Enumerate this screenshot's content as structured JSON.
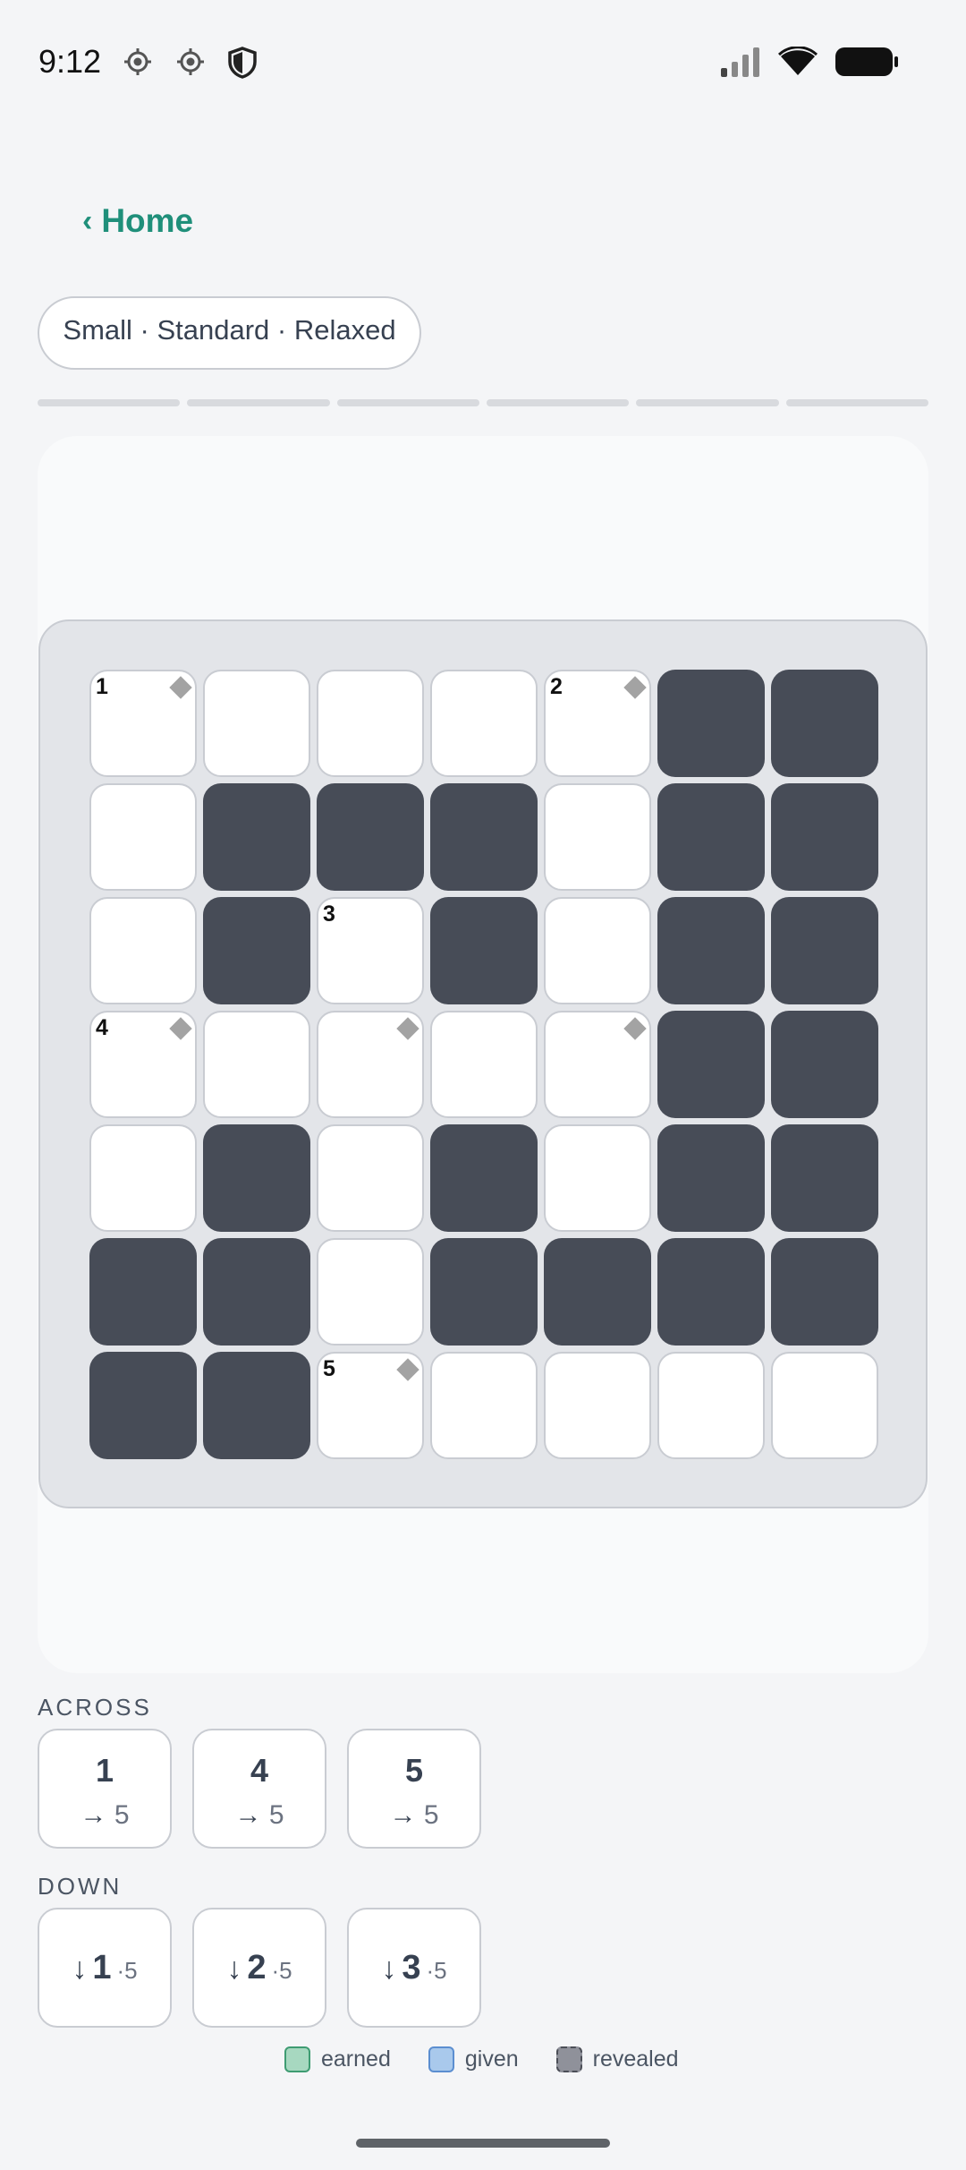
{
  "status_bar": {
    "time": "9:12",
    "icons": [
      "gps-icon",
      "gps-icon",
      "shield-icon"
    ],
    "right_icons": [
      "signal-icon",
      "wifi-icon",
      "battery-icon"
    ]
  },
  "nav": {
    "back_chevron": "‹",
    "back_label": "Home"
  },
  "chip": {
    "label": "Small · Standard · Relaxed"
  },
  "progress": {
    "segments": 6,
    "filled": 0
  },
  "board": {
    "rows": [
      [
        "W",
        "W",
        "W",
        "W",
        "W",
        "B",
        "B"
      ],
      [
        "W",
        "B",
        "B",
        "B",
        "W",
        "B",
        "B"
      ],
      [
        "W",
        "B",
        "W",
        "B",
        "W",
        "B",
        "B"
      ],
      [
        "W",
        "W",
        "W",
        "W",
        "W",
        "B",
        "B"
      ],
      [
        "W",
        "B",
        "W",
        "B",
        "W",
        "B",
        "B"
      ],
      [
        "B",
        "B",
        "W",
        "B",
        "B",
        "B",
        "B"
      ],
      [
        "B",
        "B",
        "W",
        "W",
        "W",
        "W",
        "W"
      ]
    ],
    "numbers": [
      {
        "r": 0,
        "c": 0,
        "n": "1"
      },
      {
        "r": 0,
        "c": 4,
        "n": "2"
      },
      {
        "r": 2,
        "c": 2,
        "n": "3"
      },
      {
        "r": 3,
        "c": 0,
        "n": "4"
      },
      {
        "r": 6,
        "c": 2,
        "n": "5"
      }
    ],
    "hint_markers": [
      {
        "r": 0,
        "c": 0
      },
      {
        "r": 0,
        "c": 4
      },
      {
        "r": 3,
        "c": 0
      },
      {
        "r": 3,
        "c": 2
      },
      {
        "r": 3,
        "c": 4
      },
      {
        "r": 6,
        "c": 2
      }
    ]
  },
  "across": {
    "label": "ACROSS",
    "clues": [
      {
        "num": "1",
        "arrow": "→",
        "length": "5"
      },
      {
        "num": "4",
        "arrow": "→",
        "length": "5"
      },
      {
        "num": "5",
        "arrow": "→",
        "length": "5"
      }
    ]
  },
  "down": {
    "label": "DOWN",
    "clues": [
      {
        "num": "1",
        "arrow": "↓",
        "length": "·5"
      },
      {
        "num": "2",
        "arrow": "↓",
        "length": "·5"
      },
      {
        "num": "3",
        "arrow": "↓",
        "length": "·5"
      }
    ]
  },
  "legend": {
    "earned": "earned",
    "given": "given",
    "revealed": "revealed"
  },
  "colors": {
    "accent": "#1f8f7a",
    "black_cell": "#474c57",
    "earned": "#a7d8c0",
    "given": "#a9c9ec",
    "revealed": "#8f919a"
  }
}
